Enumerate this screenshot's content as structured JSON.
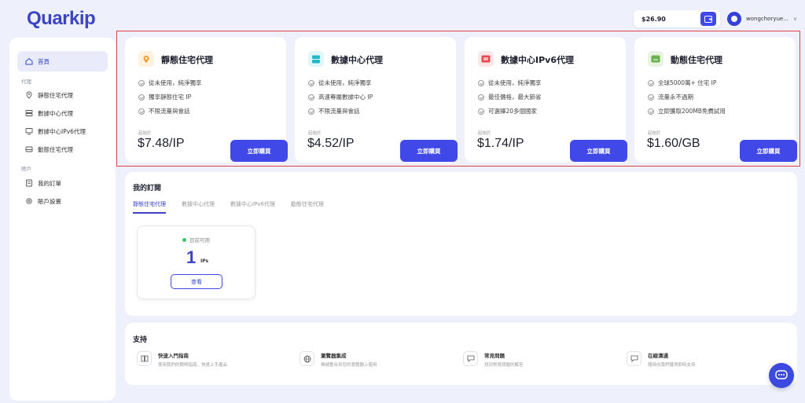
{
  "brand": {
    "logo_text": "Quarkip"
  },
  "header": {
    "balance": "$26.90",
    "username": "wongchoryue..."
  },
  "sidebar": {
    "home": "首頁",
    "proxy_section": "代理",
    "proxy_items": [
      {
        "label": "靜態住宅代理",
        "icon": "location-pin-icon"
      },
      {
        "label": "數據中心代理",
        "icon": "server-icon"
      },
      {
        "label": "數據中心IPv6代理",
        "icon": "monitor-icon"
      },
      {
        "label": "動態住宅代理",
        "icon": "storage-icon"
      }
    ],
    "account_section": "賬戶",
    "account_items": [
      {
        "label": "我的訂單",
        "icon": "orders-icon"
      },
      {
        "label": "賬戶設置",
        "icon": "gear-icon"
      }
    ]
  },
  "products": [
    {
      "title": "靜態住宅代理",
      "icon_color": "#f2a33a",
      "icon_bg": "#fdf1e0",
      "features": [
        "從未使用，純淨獨享",
        "獨享靜態住宅 IP",
        "不限流量與會話"
      ],
      "from_label": "起始於",
      "price": "$7.48/IP",
      "button": "立即購買"
    },
    {
      "title": "數據中心代理",
      "icon_color": "#22b8c8",
      "icon_bg": "#e0f6f8",
      "features": [
        "從未使用，純淨獨享",
        "高速專屬數據中心 IP",
        "不限流量與會話"
      ],
      "from_label": "起始於",
      "price": "$4.52/IP",
      "button": "立即購買"
    },
    {
      "title": "數據中心IPv6代理",
      "icon_color": "#e5484d",
      "icon_bg": "#fde6e7",
      "features": [
        "從未使用，純淨獨享",
        "最佳價格，最大節省",
        "可選擇20多個國家"
      ],
      "from_label": "起始於",
      "price": "$1.74/IP",
      "button": "立即購買"
    },
    {
      "title": "動態住宅代理",
      "icon_color": "#6ab04c",
      "icon_bg": "#e8f4e1",
      "features": [
        "全球5000萬+ 住宅 IP",
        "流量永不過期",
        "立即獲取200MB免費試用"
      ],
      "from_label": "起始於",
      "price": "$1.60/GB",
      "button": "立即購買"
    }
  ],
  "subscriptions": {
    "title": "我的訂閱",
    "tabs": [
      "靜態住宅代理",
      "數據中心代理",
      "數據中心IPv6代理",
      "動態住宅代理"
    ],
    "status": "目前可用",
    "count": "1",
    "unit": "IPs",
    "view_button": "查看"
  },
  "support": {
    "title": "支持",
    "items": [
      {
        "title": "快速入門指南",
        "desc": "使用我們的簡明指南，快速上手產品",
        "icon": "book-icon"
      },
      {
        "title": "瀏覽器集成",
        "desc": "無縫整合到您的瀏覽器上使用",
        "icon": "globe-icon"
      },
      {
        "title": "常見問題",
        "desc": "找到常見問題的解答",
        "icon": "faq-icon"
      },
      {
        "title": "在線溝通",
        "desc": "隨時向我們獲得即時支持",
        "icon": "chat-icon"
      }
    ]
  }
}
